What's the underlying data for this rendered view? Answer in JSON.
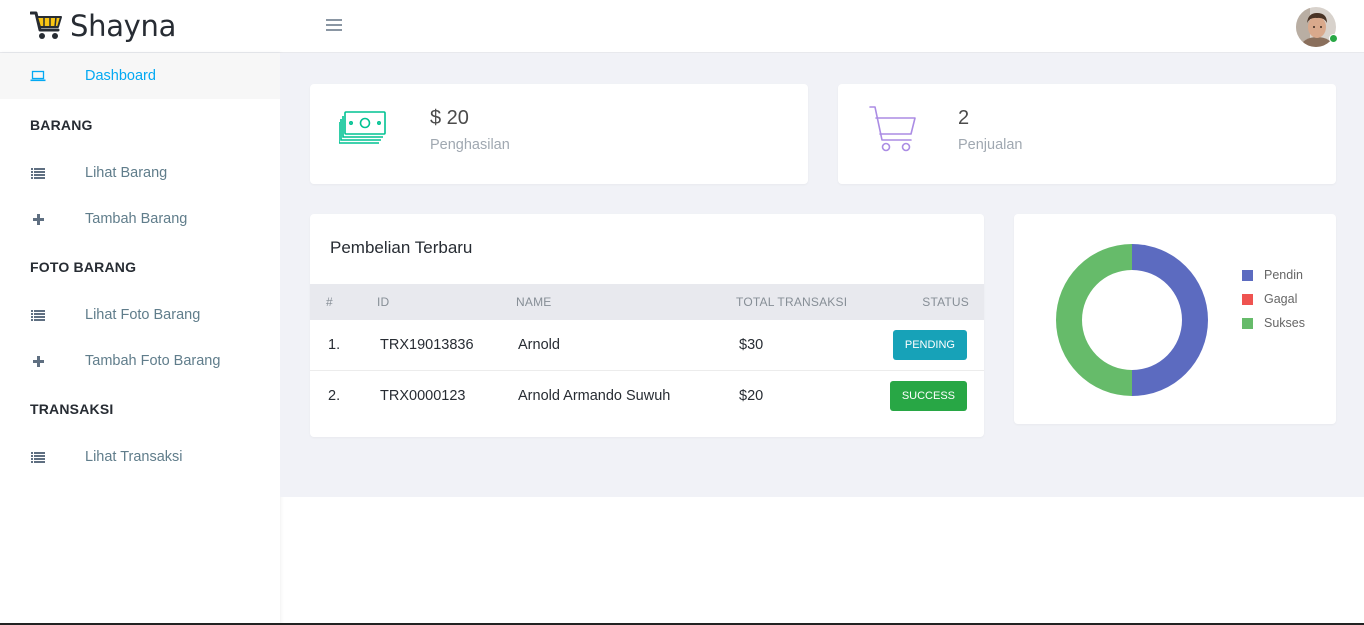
{
  "app": {
    "brand": "Shayna"
  },
  "sidebar": {
    "dashboard": "Dashboard",
    "sections": [
      {
        "heading": "BARANG",
        "items": [
          "Lihat Barang",
          "Tambah Barang"
        ]
      },
      {
        "heading": "FOTO BARANG",
        "items": [
          "Lihat Foto Barang",
          "Tambah Foto Barang"
        ]
      },
      {
        "heading": "TRANSAKSI",
        "items": [
          "Lihat Transaksi"
        ]
      }
    ]
  },
  "stats": {
    "income": {
      "value": "$ 20",
      "label": "Penghasilan",
      "color": "#00c292"
    },
    "sales": {
      "value": "2",
      "label": "Penjualan",
      "color": "#ab8ce4"
    }
  },
  "transactions": {
    "title": "Pembelian Terbaru",
    "columns": [
      "#",
      "ID",
      "NAME",
      "TOTAL TRANSAKSI",
      "STATUS"
    ],
    "rows": [
      {
        "no": "1.",
        "id": "TRX19013836",
        "name": "Arnold",
        "total": "$30",
        "status": "PENDING",
        "status_color": "#17a2b8"
      },
      {
        "no": "2.",
        "id": "TRX0000123",
        "name": "Arnold Armando Suwuh",
        "total": "$20",
        "status": "SUCCESS",
        "status_color": "#28a745"
      }
    ]
  },
  "chart_data": {
    "type": "pie",
    "labels": [
      "Pendin",
      "Gagal",
      "Sukses"
    ],
    "values": [
      1,
      0,
      1
    ],
    "colors": [
      "#5c6bc0",
      "#ef5350",
      "#66bb6a"
    ],
    "legend": "right"
  }
}
